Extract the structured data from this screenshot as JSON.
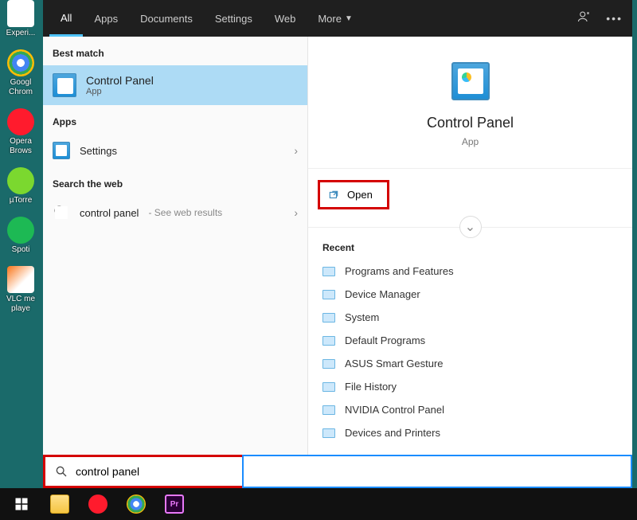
{
  "desktop": {
    "icons": [
      {
        "label": "Experi..."
      },
      {
        "label": "Googl Chrom"
      },
      {
        "label": "Opera Brows"
      },
      {
        "label": "µTorre"
      },
      {
        "label": "Spoti"
      },
      {
        "label": "VLC me playe"
      }
    ]
  },
  "tabs": {
    "items": [
      "All",
      "Apps",
      "Documents",
      "Settings",
      "Web",
      "More"
    ],
    "active": 0
  },
  "left": {
    "best_match_hdr": "Best match",
    "bm_title": "Control Panel",
    "bm_sub": "App",
    "apps_hdr": "Apps",
    "settings_label": "Settings",
    "web_hdr": "Search the web",
    "web_query": "control panel",
    "web_hint": "- See web results"
  },
  "right": {
    "hero_title": "Control Panel",
    "hero_sub": "App",
    "open_label": "Open",
    "recent_hdr": "Recent",
    "recent": [
      "Programs and Features",
      "Device Manager",
      "System",
      "Default Programs",
      "ASUS Smart Gesture",
      "File History",
      "NVIDIA Control Panel",
      "Devices and Printers"
    ]
  },
  "search": {
    "value": "control panel"
  },
  "taskbar_apps": [
    "start",
    "explorer",
    "opera",
    "chrome",
    "premiere"
  ]
}
